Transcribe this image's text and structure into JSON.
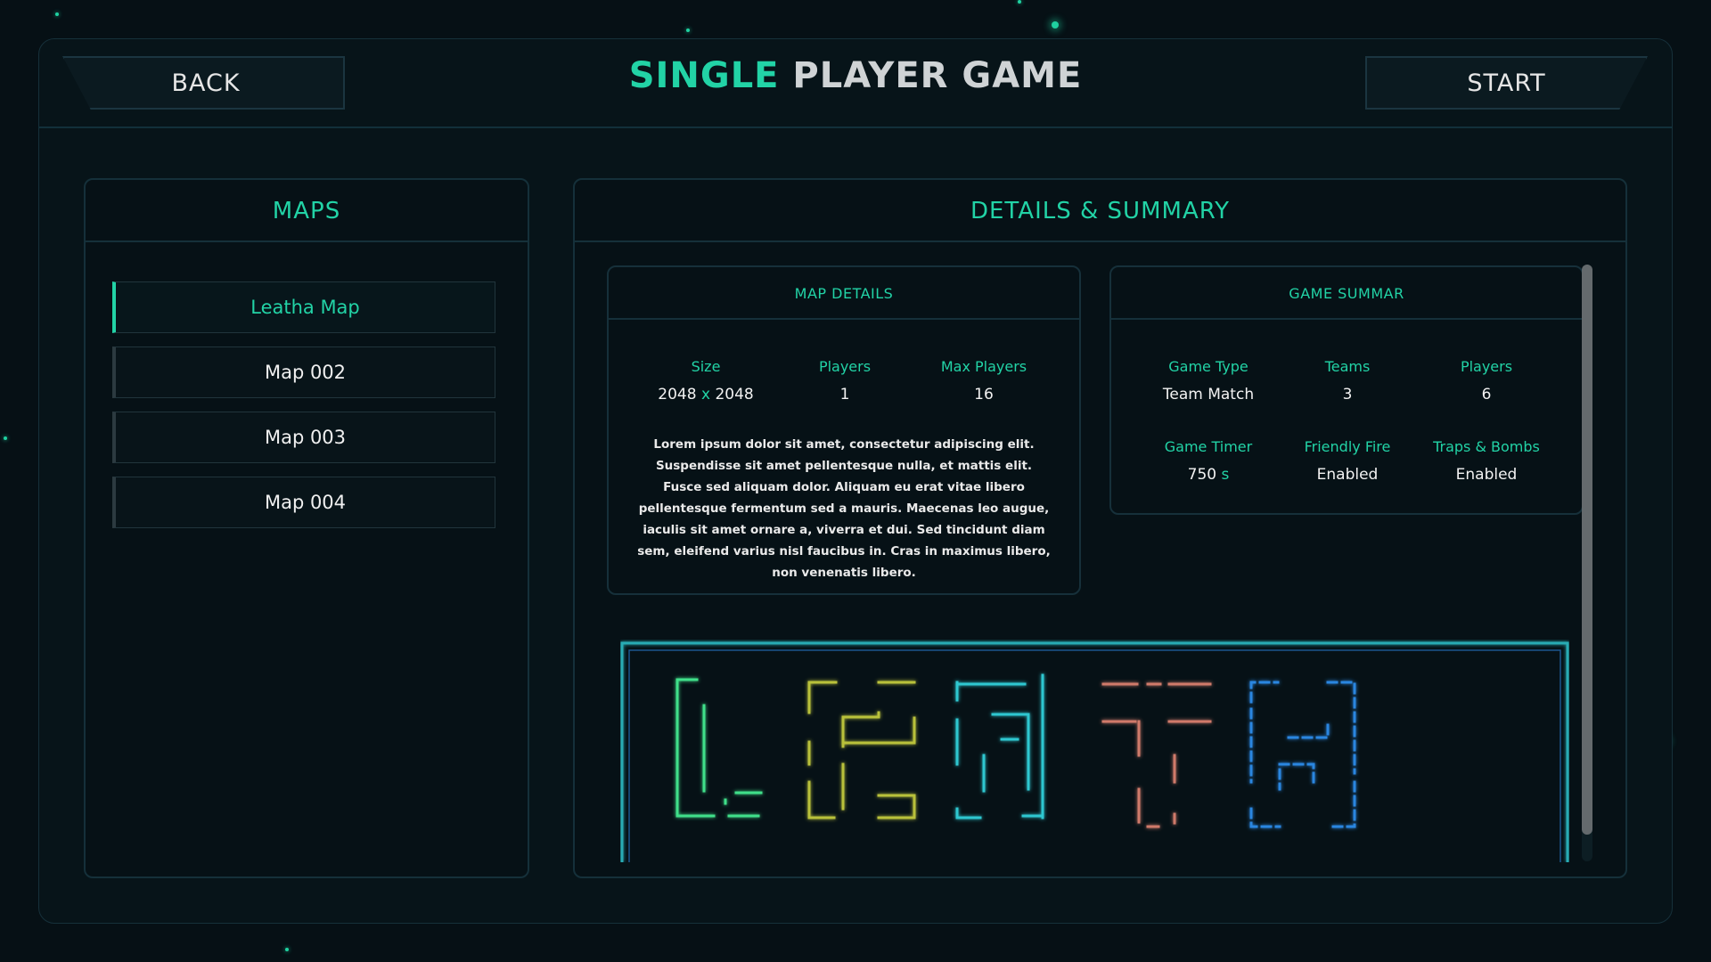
{
  "header": {
    "back_label": "BACK",
    "start_label": "START",
    "title_highlight": "SINGLE",
    "title_rest": " PLAYER GAME"
  },
  "maps_panel": {
    "title": "MAPS",
    "items": [
      {
        "label": "Leatha Map",
        "active": true
      },
      {
        "label": "Map 002",
        "active": false
      },
      {
        "label": "Map 003",
        "active": false
      },
      {
        "label": "Map 004",
        "active": false
      }
    ]
  },
  "details_panel": {
    "title": "DETAILS & SUMMARY",
    "map_details": {
      "title": "MAP DETAILS",
      "size_label": "Size",
      "size_w": "2048",
      "size_x": "x",
      "size_h": "2048",
      "players_label": "Players",
      "players_value": "1",
      "max_players_label": "Max Players",
      "max_players_value": "16",
      "description": "Lorem ipsum dolor sit amet, consectetur adipiscing elit. Suspendisse sit amet pellentesque nulla, et mattis elit. Fusce sed aliquam dolor. Aliquam eu erat vitae libero pellentesque fermentum sed a mauris. Maecenas leo augue, iaculis sit amet ornare a, viverra et dui. Sed tincidunt diam sem, eleifend varius nisl faucibus in. Cras in maximus libero, non venenatis libero."
    },
    "game_summary": {
      "title": "GAME SUMMAR",
      "game_type_label": "Game Type",
      "game_type_value": "Team Match",
      "teams_label": "Teams",
      "teams_value": "3",
      "players_label": "Players",
      "players_value": "6",
      "timer_label": "Game Timer",
      "timer_value": "750",
      "timer_unit": "s",
      "friendly_fire_label": "Friendly Fire",
      "friendly_fire_value": "Enabled",
      "traps_label": "Traps & Bombs",
      "traps_value": "Enabled"
    },
    "scroll_position": 0.0
  },
  "colors": {
    "accent": "#22d3a6",
    "background": "#061015",
    "border": "#15303a",
    "letter_L": "#3fe08a",
    "letter_E": "#b9c13a",
    "letter_A": "#2fc7d0",
    "letter_T": "#d07a6a",
    "letter_H": "#2a86e0"
  }
}
